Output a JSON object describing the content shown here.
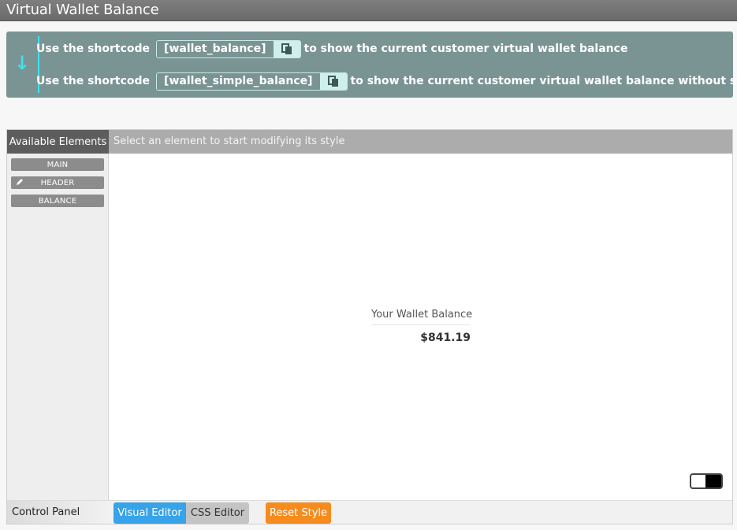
{
  "window": {
    "title": "Virtual Wallet Balance"
  },
  "shortcodes": [
    {
      "prefix": "Use the shortcode",
      "code": "[wallet_balance]",
      "suffix": "to show the current customer virtual wallet balance"
    },
    {
      "prefix": "Use the shortcode",
      "code": "[wallet_simple_balance]",
      "suffix": "to show the current customer virtual wallet balance without styling"
    }
  ],
  "editor": {
    "elements_tab": "Available Elements",
    "hint": "Select an element to start modifying its style",
    "elements": [
      {
        "label": "MAIN"
      },
      {
        "label": "HEADER"
      },
      {
        "label": "BALANCE"
      }
    ],
    "preview": {
      "header": "Your Wallet Balance",
      "balance": "$841.19"
    }
  },
  "control_panel": {
    "label": "Control Panel",
    "visual_editor": "Visual Editor",
    "css_editor": "CSS Editor",
    "reset_style": "Reset Style"
  },
  "icons": {
    "arrow": "arrow-down-icon",
    "copy": "copy-icon",
    "pencil": "pencil-icon"
  },
  "colors": {
    "info_bg": "#7a9494",
    "accent_cyan": "#3fe0ec",
    "visual_editor_blue": "#37a3e8",
    "reset_orange": "#f68b1e"
  }
}
